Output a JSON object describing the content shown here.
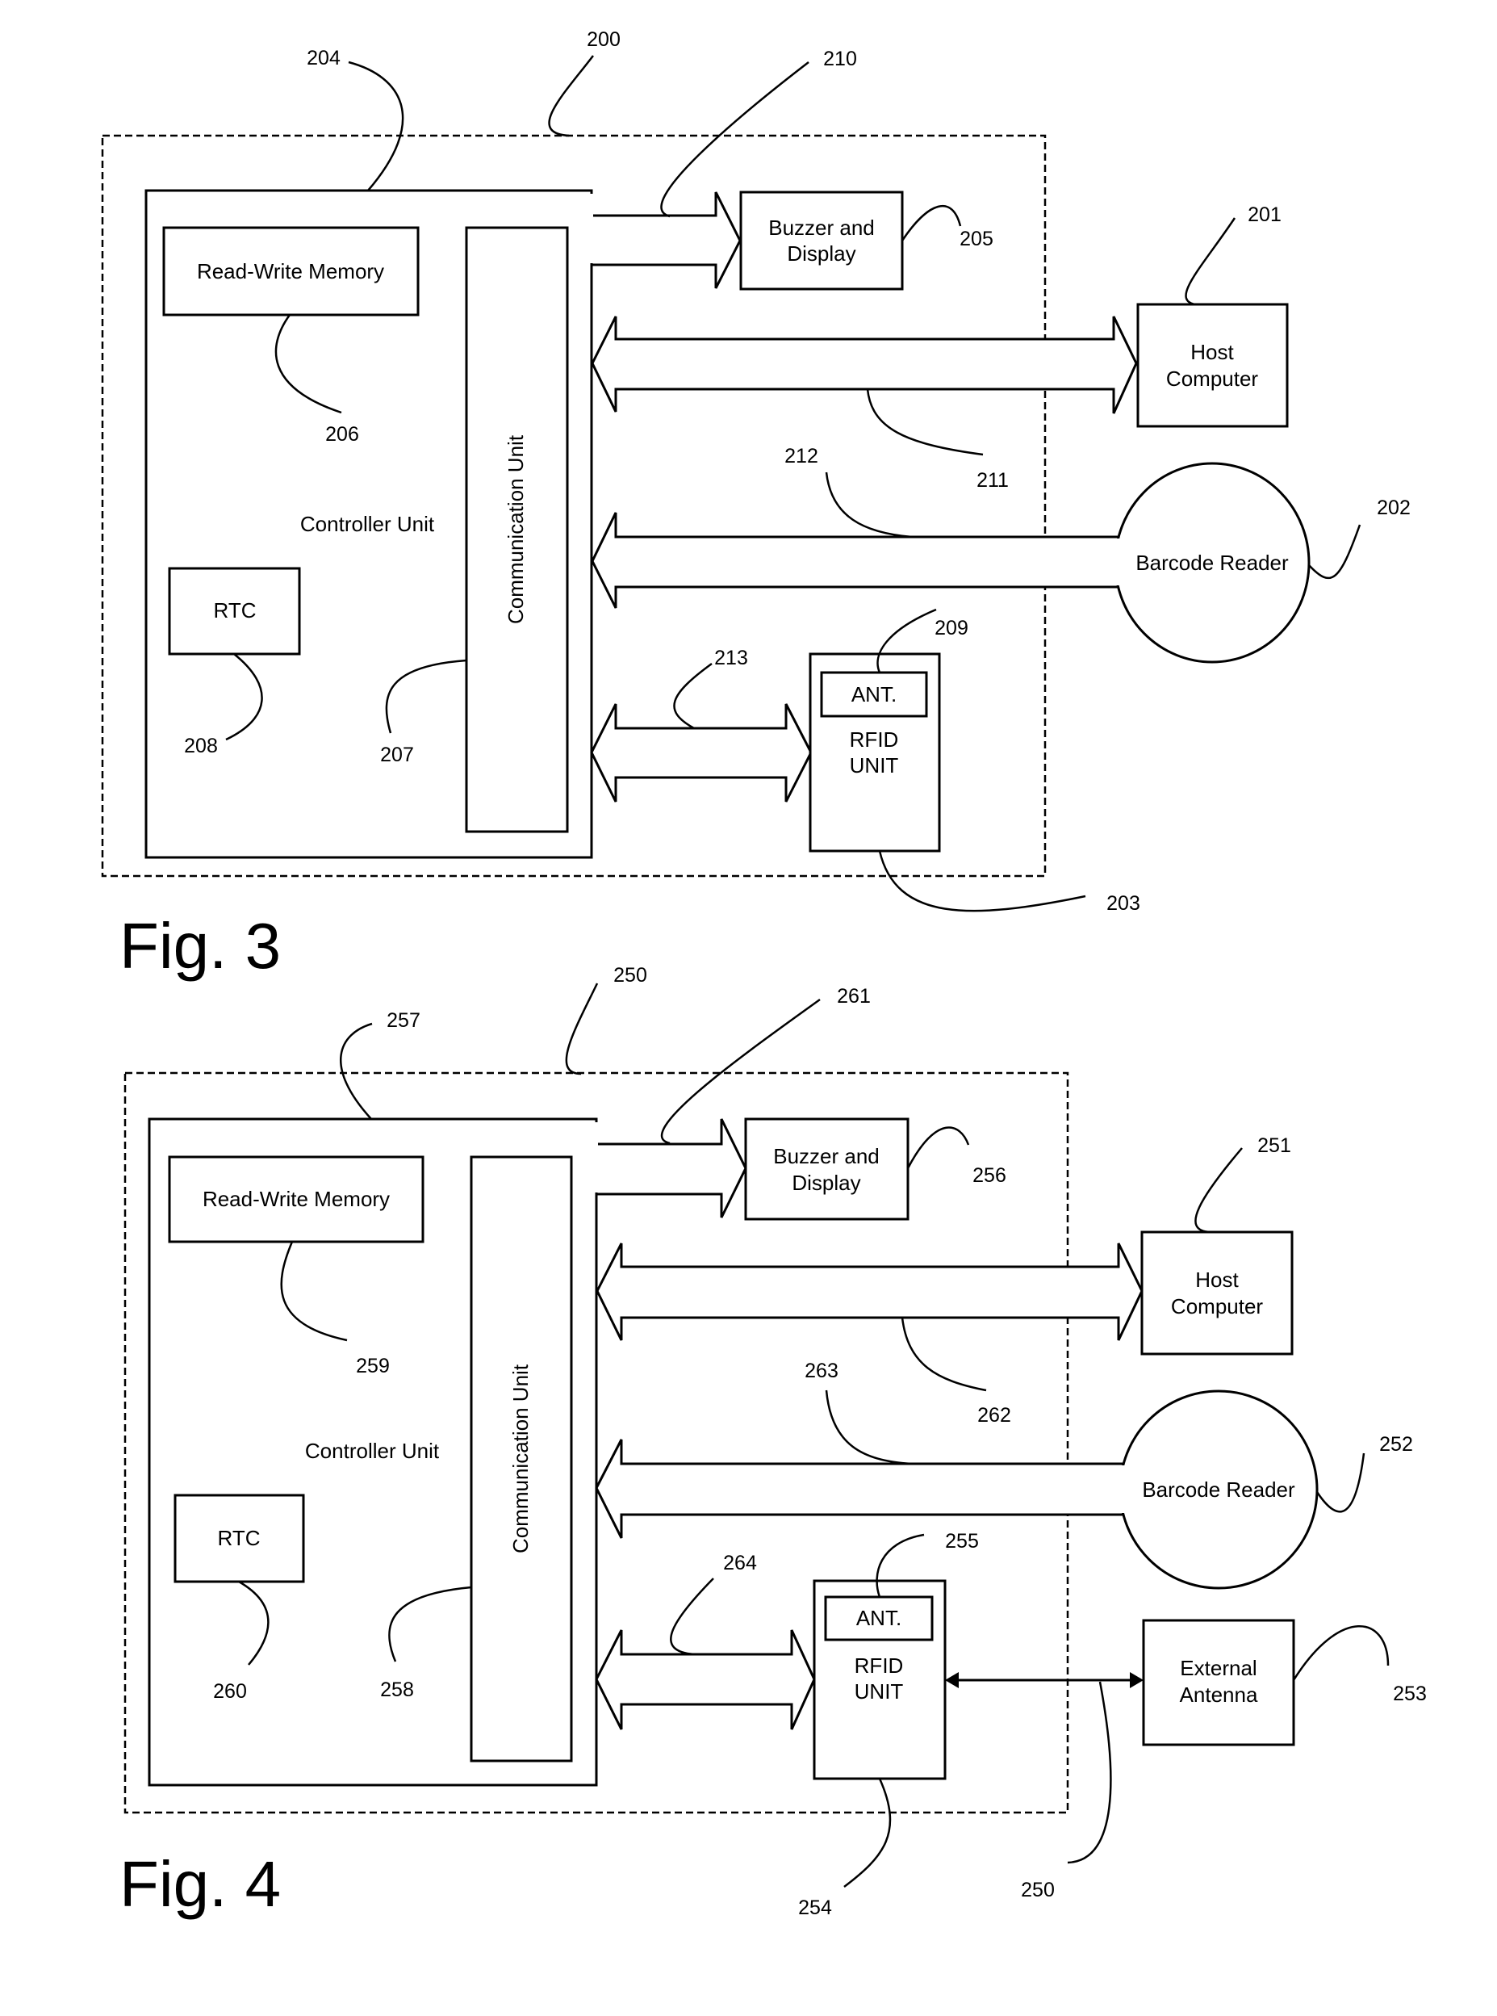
{
  "figures": [
    {
      "title": "Fig. 3",
      "blocks": {
        "controller": "Controller Unit",
        "memory": "Read-Write Memory",
        "rtc": "RTC",
        "comm": "Communication Unit",
        "buzzer_line1": "Buzzer  and",
        "buzzer_line2": "Display",
        "host_line1": "Host",
        "host_line2": "Computer",
        "barcode": "Barcode Reader",
        "antenna": "ANT.",
        "rfid_line1": "RFID",
        "rfid_line2": "UNIT"
      },
      "refs": {
        "system": "200",
        "host": "201",
        "barcode": "202",
        "rfid": "203",
        "controller": "204",
        "buzzer": "205",
        "memory": "206",
        "comm": "207",
        "rtc": "208",
        "antenna": "209",
        "buzzer_link": "210",
        "host_link": "211",
        "barcode_link": "212",
        "rfid_link": "213"
      }
    },
    {
      "title": "Fig. 4",
      "blocks": {
        "controller": "Controller Unit",
        "memory": "Read-Write Memory",
        "rtc": "RTC",
        "comm": "Communication Unit",
        "buzzer_line1": "Buzzer  and",
        "buzzer_line2": "Display",
        "host_line1": "Host",
        "host_line2": "Computer",
        "barcode": "Barcode Reader",
        "antenna": "ANT.",
        "rfid_line1": "RFID",
        "rfid_line2": "UNIT",
        "ext_line1": "External",
        "ext_line2": "Antenna"
      },
      "refs": {
        "system": "250",
        "host": "251",
        "barcode": "252",
        "ext_antenna": "253",
        "rfid": "254",
        "antenna": "255",
        "buzzer": "256",
        "controller": "257",
        "comm": "258",
        "memory": "259",
        "rtc": "260",
        "buzzer_link": "261",
        "host_link": "262",
        "barcode_link": "263",
        "rfid_link": "264",
        "ext_link": "250"
      }
    }
  ]
}
